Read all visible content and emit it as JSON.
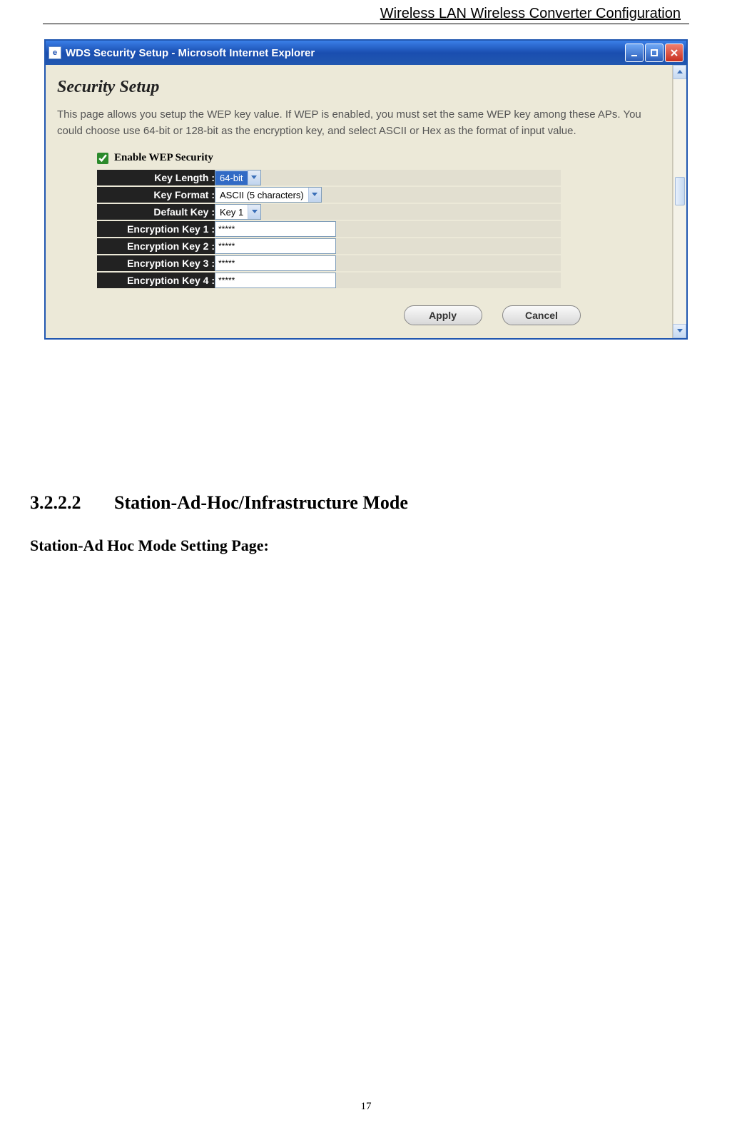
{
  "doc_header": "Wireless LAN Wireless Converter Configuration",
  "window": {
    "title": "WDS Security Setup - Microsoft Internet Explorer",
    "page_title": "Security Setup",
    "description": "This page allows you setup the WEP key value. If WEP is enabled, you must set the same WEP key among these APs. You could choose use 64-bit or 128-bit as the encryption key, and select ASCII or Hex as the format of input value.",
    "enable_checkbox_label": "Enable WEP Security",
    "enable_checked": true,
    "rows": [
      {
        "label": "Key Length :",
        "type": "select",
        "value": "64-bit",
        "highlighted": true
      },
      {
        "label": "Key Format :",
        "type": "select",
        "value": "ASCII (5 characters)",
        "highlighted": false
      },
      {
        "label": "Default Key :",
        "type": "select",
        "value": "Key 1",
        "highlighted": false
      },
      {
        "label": "Encryption Key 1 :",
        "type": "text",
        "value": "*****"
      },
      {
        "label": "Encryption Key 2 :",
        "type": "text",
        "value": "*****"
      },
      {
        "label": "Encryption Key 3 :",
        "type": "text",
        "value": "*****"
      },
      {
        "label": "Encryption Key 4 :",
        "type": "text",
        "value": "*****"
      }
    ],
    "buttons": {
      "apply": "Apply",
      "cancel": "Cancel"
    }
  },
  "section": {
    "number": "3.2.2.2",
    "title": "Station-Ad-Hoc/Infrastructure Mode"
  },
  "sub_section": "Station-Ad Hoc Mode Setting Page:",
  "page_number": "17"
}
